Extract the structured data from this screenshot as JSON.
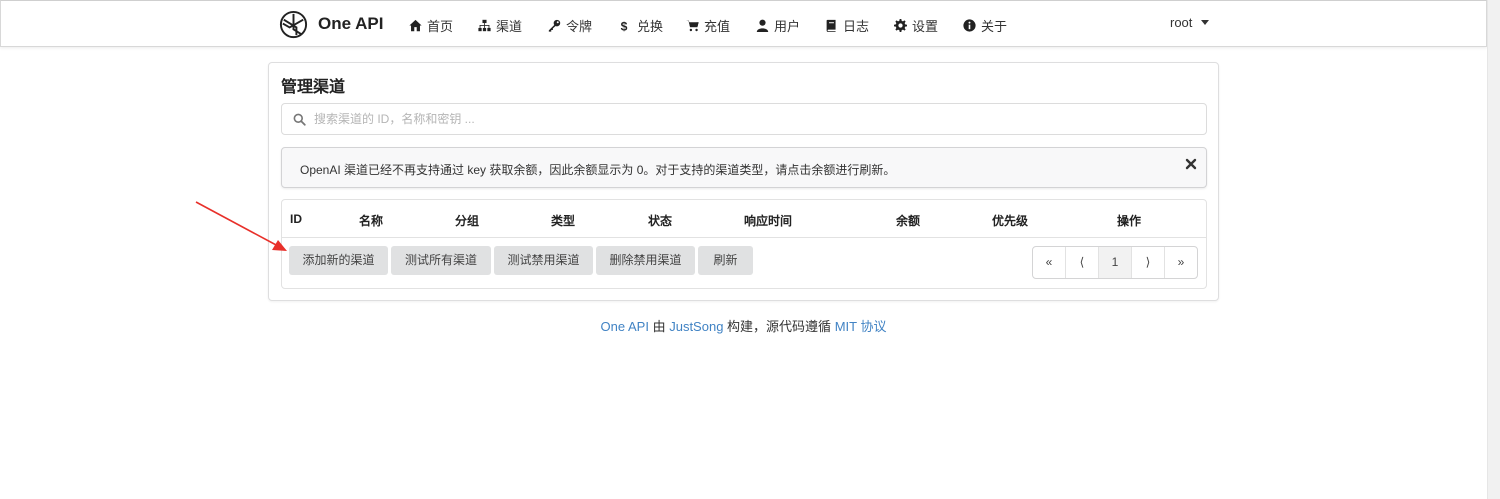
{
  "navbar": {
    "brand": "One API",
    "items": [
      {
        "label": "首页",
        "icon": "home-icon"
      },
      {
        "label": "渠道",
        "icon": "sitemap-icon"
      },
      {
        "label": "令牌",
        "icon": "key-icon"
      },
      {
        "label": "兑换",
        "icon": "dollar-icon"
      },
      {
        "label": "充值",
        "icon": "cart-icon"
      },
      {
        "label": "用户",
        "icon": "user-icon"
      },
      {
        "label": "日志",
        "icon": "book-icon"
      },
      {
        "label": "设置",
        "icon": "gear-icon"
      },
      {
        "label": "关于",
        "icon": "info-icon"
      }
    ],
    "user": "root"
  },
  "page": {
    "title": "管理渠道",
    "search_placeholder": "搜索渠道的 ID，名称和密钥 ...",
    "notice": "OpenAI 渠道已经不再支持通过 key 获取余额，因此余额显示为 0。对于支持的渠道类型，请点击余额进行刷新。",
    "columns": [
      "ID",
      "名称",
      "分组",
      "类型",
      "状态",
      "响应时间",
      "余额",
      "优先级",
      "操作"
    ],
    "buttons": [
      "添加新的渠道",
      "测试所有渠道",
      "测试禁用渠道",
      "删除禁用渠道",
      "刷新"
    ],
    "pagination": [
      "«",
      "⟨",
      "1",
      "⟩",
      "»"
    ]
  },
  "footer": {
    "brand_link": "One API",
    "by": "由",
    "author_link": "JustSong",
    "middle": "构建，源代码遵循",
    "license_link": "MIT 协议"
  },
  "colors": {
    "link": "#4183c4",
    "annotation_arrow": "#e8302a",
    "button_bg": "#e0e1e2"
  }
}
